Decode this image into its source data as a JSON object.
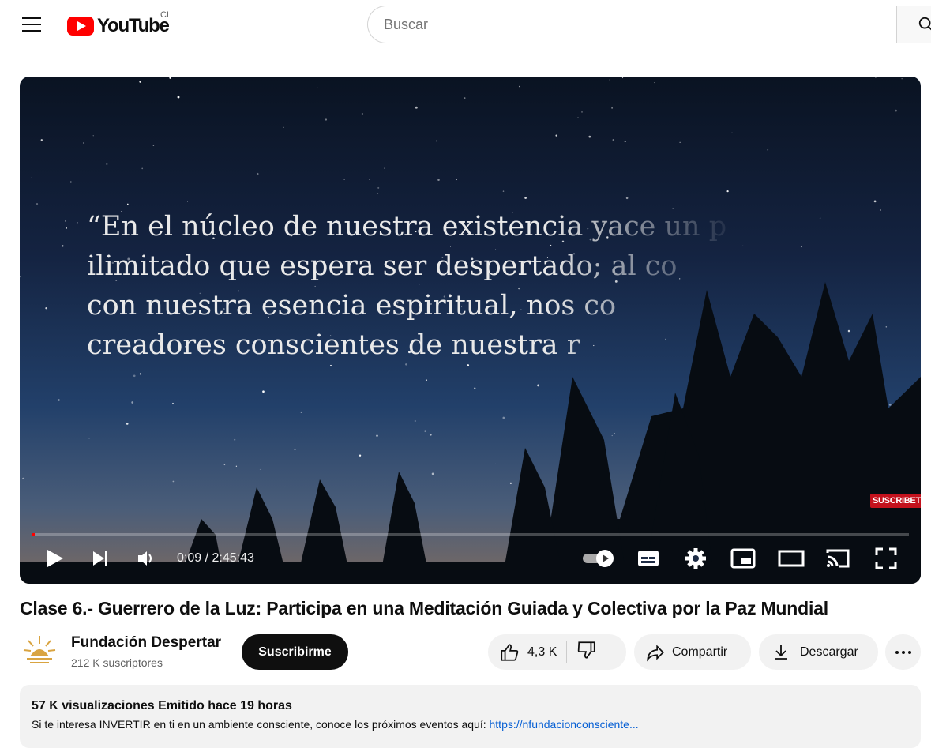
{
  "header": {
    "logo_text": "YouTube",
    "country_code": "CL",
    "search_placeholder": "Buscar"
  },
  "player": {
    "quote_lines": [
      "“En el núcleo de nuestra existencia yace un p",
      "ilimitado que espera ser despertado; al co",
      "con nuestra esencia espiritual, nos co",
      "creadores conscientes de nuestra r"
    ],
    "subscribe_overlay": "SUSCRIBETE",
    "current_time": "0:09",
    "duration": "2:45:43",
    "time_separator": " / ",
    "progress_fraction": 0.0009
  },
  "video": {
    "title": "Clase 6.- Guerrero de la Luz: Participa en una Meditación Guiada y Colectiva por la Paz Mundial",
    "channel_name": "Fundación Despertar",
    "subscribers": "212 K suscriptores",
    "subscribe_label": "Suscribirme",
    "likes": "4,3 K",
    "share_label": "Compartir",
    "download_label": "Descargar"
  },
  "description": {
    "meta": "57 K visualizaciones  Emitido hace 19 horas",
    "text": "Si te interesa INVERTIR en ti en un ambiente consciente, conoce los próximos eventos aquí: ",
    "link": "https://nfundacionconsciente..."
  },
  "colors": {
    "brand_red": "#ff0000",
    "subscribe_bg": "#0f0f0f",
    "pill_bg": "#f2f2f2",
    "link": "#065fd4"
  }
}
